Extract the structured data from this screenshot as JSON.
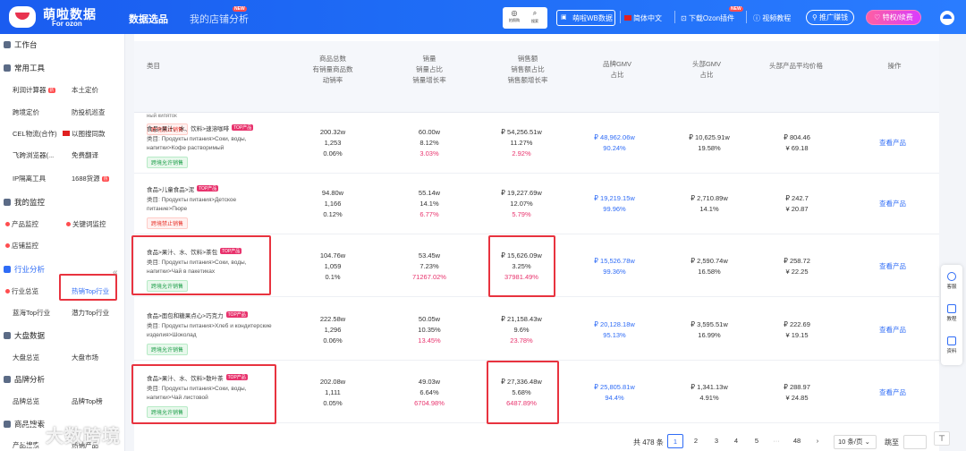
{
  "header": {
    "logo_name": "萌啦数据",
    "logo_sub": "For ozon",
    "tabs": [
      {
        "label": "数据选品",
        "active": true
      },
      {
        "label": "我的店铺分析",
        "active": false,
        "badge": "NEW"
      }
    ],
    "icon_buttons": [
      {
        "label": "拍照购"
      },
      {
        "label": "搜索"
      }
    ],
    "wb_button": "萌啦WB数据",
    "language": "简体中文",
    "download_plugin": "下载Ozon插件",
    "download_badge": "NEW",
    "video_tutorial": "视频教程",
    "promo_button": "推广赚钱",
    "vip_button": "特权/续费"
  },
  "sidebar": {
    "workbench": "工作台",
    "common_tools": {
      "title": "常用工具",
      "items": [
        {
          "label": "利润计算器",
          "badge": "新"
        },
        {
          "label": "本土定价"
        },
        {
          "label": "跨境定价"
        },
        {
          "label": "防投机巡查"
        },
        {
          "label": "CEL物流(合作)"
        },
        {
          "label": "以图搜同款"
        },
        {
          "label": "飞跨浏览器(..."
        },
        {
          "label": "免费翻译"
        },
        {
          "label": "IP隔离工具"
        },
        {
          "label": "1688货源",
          "badge": "热"
        }
      ]
    },
    "my_monitor": {
      "title": "我的监控",
      "items": [
        {
          "label": "产品监控"
        },
        {
          "label": "关键词监控"
        },
        {
          "label": "店铺监控"
        }
      ]
    },
    "industry": {
      "title": "行业分析",
      "items": [
        {
          "label": "行业总览"
        },
        {
          "label": "热销Top行业",
          "active": true
        },
        {
          "label": "蓝海Top行业"
        },
        {
          "label": "潜力Top行业"
        }
      ]
    },
    "market": {
      "title": "大盘数据",
      "items": [
        {
          "label": "大盘总览"
        },
        {
          "label": "大盘市场"
        }
      ]
    },
    "brand": {
      "title": "品牌分析",
      "items": [
        {
          "label": "品牌总览"
        },
        {
          "label": "品牌Top榜"
        }
      ]
    },
    "product": {
      "title": "商品搜索",
      "items": [
        {
          "label": "产品搜索"
        },
        {
          "label": "热销产品"
        }
      ]
    },
    "watermark": "大数跨境"
  },
  "table": {
    "headers": {
      "category": "类目",
      "products": [
        "商品总数",
        "有销量商品数",
        "动销率"
      ],
      "sales": [
        "销量",
        "销量占比",
        "销量增长率"
      ],
      "revenue": [
        "销售额",
        "销售额占比",
        "销售额增长率"
      ],
      "brand_gmv": [
        "品牌GMV",
        "占比"
      ],
      "head_gmv": [
        "头部GMV",
        "占比"
      ],
      "head_price": "头部产品平均价格",
      "action": "操作"
    },
    "prev_row_tail": "ный кипяток",
    "prev_row_tag": "跨境禁止销售",
    "top_badge": "TOP产品",
    "path_label": "类目:",
    "view_label": "查看产品",
    "rows": [
      {
        "category": "食品>果汁、水、饮料>速溶咖啡",
        "path": "Продукты питания>Соки, воды, напитки>Кофе растворимый",
        "tag": "跨境允许销售",
        "tag_type": "allow",
        "products": [
          "200.32w",
          "1,253",
          "0.06%"
        ],
        "sales": [
          "60.00w",
          "8.12%",
          "3.03%"
        ],
        "revenue": [
          "₽ 54,256.51w",
          "11.27%",
          "2.92%"
        ],
        "brand_gmv": [
          "₽ 48,962.06w",
          "90.24%"
        ],
        "head_gmv": [
          "₽ 10,625.91w",
          "19.58%"
        ],
        "price": [
          "₽ 804.46",
          "¥ 69.18"
        ]
      },
      {
        "category": "食品>儿童食品>泥",
        "path": "Продукты питания>Детское питание>Пюре",
        "tag": "跨境禁止销售",
        "tag_type": "ban",
        "products": [
          "94.80w",
          "1,166",
          "0.12%"
        ],
        "sales": [
          "55.14w",
          "14.1%",
          "6.77%"
        ],
        "revenue": [
          "₽ 19,227.69w",
          "12.07%",
          "5.79%"
        ],
        "brand_gmv": [
          "₽ 19,219.15w",
          "99.96%"
        ],
        "head_gmv": [
          "₽ 2,710.89w",
          "14.1%"
        ],
        "price": [
          "₽ 242.7",
          "¥ 20.87"
        ]
      },
      {
        "category": "食品>果汁、水、饮料>茶包",
        "path": "Продукты питания>Соки, воды, напитки>Чай в пакетиках",
        "tag": "跨境允许销售",
        "tag_type": "allow",
        "products": [
          "104.76w",
          "1,059",
          "0.1%"
        ],
        "sales": [
          "53.45w",
          "7.23%",
          "71267.02%"
        ],
        "revenue": [
          "₽ 15,626.09w",
          "3.25%",
          "37981.49%"
        ],
        "brand_gmv": [
          "₽ 15,526.78w",
          "99.36%"
        ],
        "head_gmv": [
          "₽ 2,590.74w",
          "16.58%"
        ],
        "price": [
          "₽ 258.72",
          "¥ 22.25"
        ]
      },
      {
        "category": "食品>面包和糖果点心>巧克力",
        "path": "Продукты питания>Хлеб и кондитерские изделия>Шоколад",
        "tag": "跨境允许销售",
        "tag_type": "allow",
        "products": [
          "222.58w",
          "1,296",
          "0.06%"
        ],
        "sales": [
          "50.05w",
          "10.35%",
          "13.45%"
        ],
        "revenue": [
          "₽ 21,158.43w",
          "9.6%",
          "23.78%"
        ],
        "brand_gmv": [
          "₽ 20,128.18w",
          "95.13%"
        ],
        "head_gmv": [
          "₽ 3,595.51w",
          "16.99%"
        ],
        "price": [
          "₽ 222.69",
          "¥ 19.15"
        ]
      },
      {
        "category": "食品>果汁、水、饮料>散叶茶",
        "path": "Продукты питания>Соки, воды, напитки>Чай листовой",
        "tag": "跨境允许销售",
        "tag_type": "allow",
        "products": [
          "202.08w",
          "1,111",
          "0.05%"
        ],
        "sales": [
          "49.03w",
          "6.64%",
          "6704.98%"
        ],
        "revenue": [
          "₽ 27,336.48w",
          "5.68%",
          "6487.89%"
        ],
        "brand_gmv": [
          "₽ 25,805.81w",
          "94.4%"
        ],
        "head_gmv": [
          "₽ 1,341.13w",
          "4.91%"
        ],
        "price": [
          "₽ 288.97",
          "¥ 24.85"
        ]
      }
    ]
  },
  "pagination": {
    "total": "共 478 条",
    "pages": [
      "1",
      "2",
      "3",
      "4",
      "5",
      "···",
      "48",
      "›"
    ],
    "current": "1",
    "page_size": "10 条/页",
    "jump": "跳至"
  },
  "float_panel": [
    "客服",
    "教程",
    "资料"
  ],
  "colors": {
    "brand": "#1e6bf5",
    "accent_red": "#e8336d",
    "highlight": "#e8333f"
  }
}
